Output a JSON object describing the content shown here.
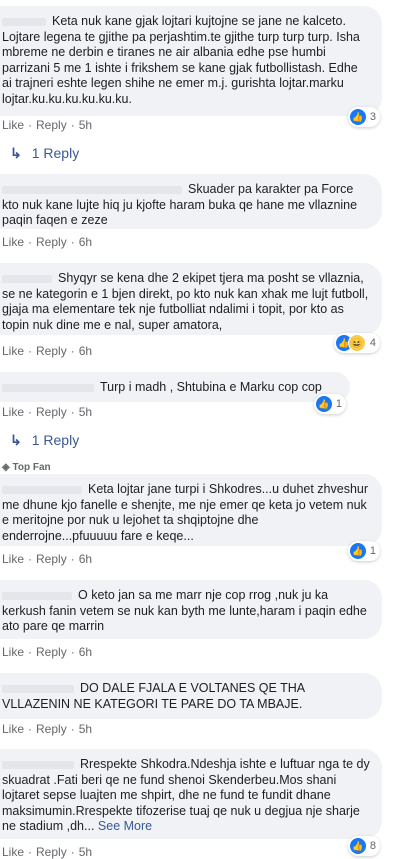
{
  "comments": [
    {
      "text": "Keta nuk kane gjak lojtari kujtojne se jane ne kalceto. Lojtare legena te gjithe pa perjashtim.te gjithe turp turp turp. Isha mbreme ne derbin e tiranes ne air albania edhe pse humbi parrizani 5 me 1 ishte i frikshem se kane gjak futbollistash. Edhe ai trajneri eshte legen shihe ne emer m.j. gurishta lojtar.marku lojtar.ku.ku.ku.ku.ku.ku.",
      "time": "5h",
      "reactions": "3"
    },
    {
      "text": "Skuader pa karakter pa Force kto nuk kane lujte hiq ju kjofte haram buka qe hane me vllaznine paqin faqen e zeze",
      "time": "6h"
    },
    {
      "text": "Shyqyr se kena dhe 2 ekipet tjera ma posht se vllaznia, se ne kategorin e 1 bjen direkt, po kto nuk kan xhak me lujt futboll, gjaja ma elementare tek nje futbolliat ndalimi i topit, por kto as topin nuk dine me e nal, super amatora,",
      "time": "6h",
      "reactions": "4"
    },
    {
      "text": "Turp i madh , Shtubina e Marku cop cop",
      "time": "5h",
      "reactions": "1"
    },
    {
      "badge": "Top Fan",
      "text": "Keta lojtar jane turpi i Shkodres...u duhet zhveshur me dhune kjo fanelle e shenjte, me nje emer qe keta jo vetem nuk e meritojne por nuk u lejohet ta shqiptojne dhe enderrojne...pfuuuuu fare e keqe...",
      "time": "6h",
      "reactions": "1"
    },
    {
      "text": "O keto jan sa me marr nje cop rrog ,nuk ju ka kerkush fanin vetem se nuk kan byth me lunte,haram i paqin edhe ato pare qe marrin",
      "time": "6h"
    },
    {
      "text": "DO DALE FJALA E VOLTANES QE THA VLLAZENIN NE KATEGORI TE PARE DO TA MBAJE.",
      "time": "5h"
    },
    {
      "text": "Rrespekte Shkodra.Ndeshja ishte e luftuar nga te dy skuadrat .Fati beri qe ne fund shenoi Skenderbeu.Mos shani lojtaret sepse luajten me shpirt, dhe ne fund te fundit dhane maksimumin.Rrespekte tifozerise tuaj qe nuk u degjua nje sharje ne stadium ,dh...",
      "see_more": "See More",
      "time": "5h",
      "reactions": "8"
    }
  ],
  "actions": {
    "like": "Like",
    "reply": "Reply",
    "dot": "·"
  },
  "replies": {
    "first": "1 Reply",
    "second": "1 Reply"
  },
  "colors": {
    "bubble": "#f0f2f5",
    "link": "#385898",
    "meta": "#65676b",
    "like_blue": "#1877f2"
  }
}
